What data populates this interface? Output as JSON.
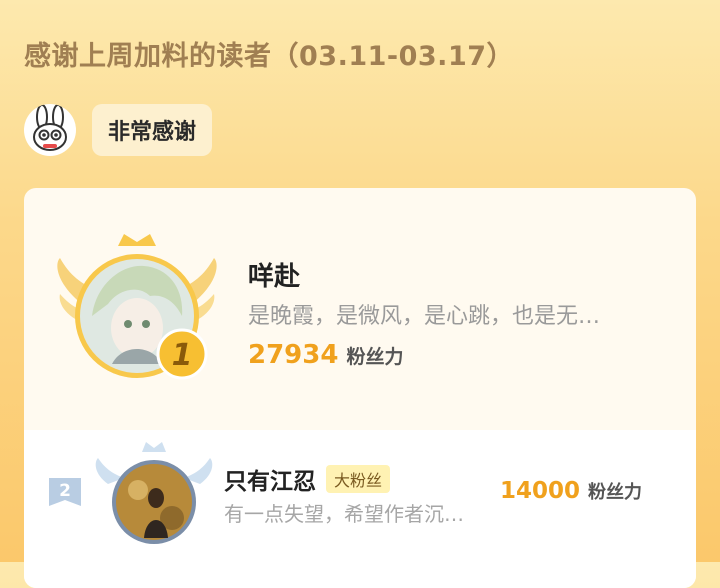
{
  "header": {
    "title": "感谢上周加料的读者（03.11-03.17）"
  },
  "thanks": {
    "mascot_icon": "bunny-mascot-icon",
    "message": "非常感谢"
  },
  "leaderboard": {
    "first": {
      "rank": "1",
      "name": "咩赴",
      "bio": "是晚霞，是微风，是心跳，也是无…",
      "fans": "27934",
      "fans_unit": "粉丝力"
    },
    "second": {
      "rank": "2",
      "name": "只有江忍",
      "tag": "大粉丝",
      "bio": "有一点失望，希望作者沉…",
      "fans": "14000",
      "fans_unit": "粉丝力"
    }
  },
  "colors": {
    "accent": "#f0a11d",
    "title": "#a07f52",
    "card": "#fffaf0"
  }
}
